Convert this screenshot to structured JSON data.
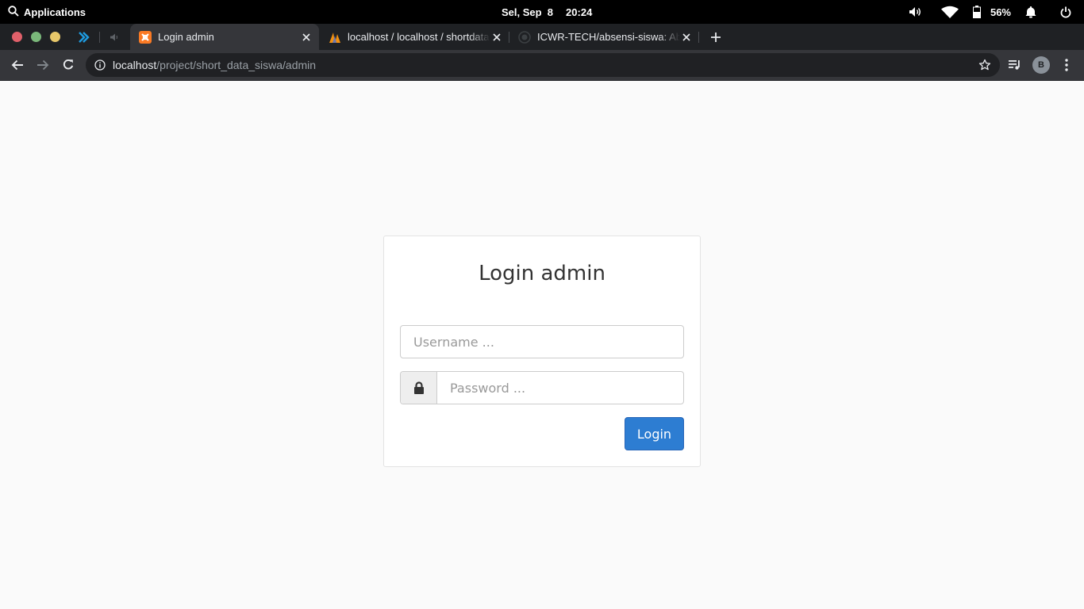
{
  "os_bar": {
    "apps_label": "Applications",
    "date": "Sel, Sep  8",
    "time": "20:24",
    "battery_percent": "56%"
  },
  "tabs": [
    {
      "title": "Login admin",
      "active": true
    },
    {
      "title": "localhost / localhost / shortdata",
      "active": false
    },
    {
      "title": "ICWR-TECH/absensi-siswa: Abs",
      "active": false
    }
  ],
  "address_bar": {
    "host": "localhost",
    "path": "/project/short_data_siswa/admin"
  },
  "profile": {
    "initial": "B"
  },
  "login": {
    "title": "Login admin",
    "username_placeholder": "Username ...",
    "username_value": "",
    "password_placeholder": "Password ...",
    "password_value": "",
    "submit_label": "Login"
  },
  "colors": {
    "primary_button": "#2d7dd2",
    "page_background": "#fafafa",
    "toolbar": "#35363a",
    "tabstrip": "#1f2124"
  }
}
